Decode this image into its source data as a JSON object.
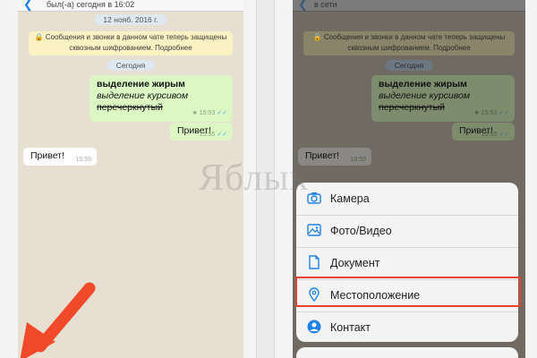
{
  "left_phone": {
    "status": "был(-а) сегодня в 16:02",
    "date_pill": "12 нояб. 2016 г.",
    "system_message": "🔒 Сообщения и звонки в данном чате теперь защищены сквозным шифрованием. Подробнее",
    "today_pill": "Сегодня",
    "messages": [
      {
        "bold": "выделение жирым",
        "italic": "выделение курсивом",
        "strike": "перечеркнутый",
        "time": "★ 15:53"
      },
      {
        "text": "Привет!",
        "time": "15:55"
      },
      {
        "text": "Привет!",
        "time": "15:59"
      }
    ]
  },
  "right_phone": {
    "status": "в сети",
    "today_pill": "Сегодня",
    "system_message": "🔒 Сообщения и звонки в данном чате теперь защищены сквозным шифрованием. Подробнее",
    "messages": [
      {
        "bold": "выделение жирым",
        "italic": "выделение курсивом",
        "strike": "перечеркнутый",
        "time": "★ 15:53"
      },
      {
        "text": "Привет!",
        "time": "15:55"
      },
      {
        "text": "Привет!",
        "time": "15:59"
      }
    ],
    "sheet_items": [
      {
        "label": "Камера",
        "icon": "camera-icon"
      },
      {
        "label": "Фото/Видео",
        "icon": "photo-icon"
      },
      {
        "label": "Документ",
        "icon": "document-icon"
      },
      {
        "label": "Местоположение",
        "icon": "location-icon"
      },
      {
        "label": "Контакт",
        "icon": "contact-icon"
      }
    ]
  },
  "watermark": "Яблык",
  "colors": {
    "highlight": "#e8432e",
    "arrow": "#f04a2a",
    "accent": "#1e82e6"
  }
}
